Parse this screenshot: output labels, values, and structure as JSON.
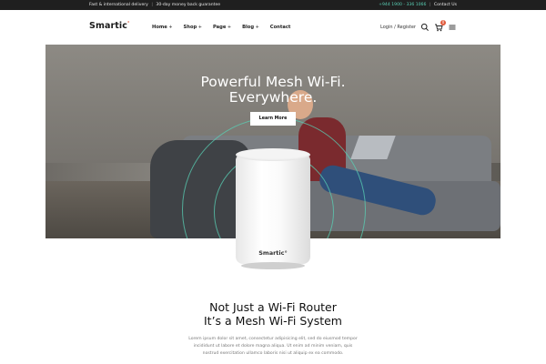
{
  "topbar": {
    "promo_left": "Fast & international delivery",
    "promo_right": "30-day money back guarantee",
    "phone": "+944 1900 - 336 1066",
    "contact": "Contact Us"
  },
  "header": {
    "logo": "Smartic",
    "logo_mark": "°",
    "nav": [
      {
        "label": "Home",
        "plus": "+"
      },
      {
        "label": "Shop",
        "plus": "+"
      },
      {
        "label": "Page",
        "plus": "+"
      },
      {
        "label": "Blog",
        "plus": "+"
      },
      {
        "label": "Contact",
        "plus": ""
      }
    ],
    "login": "Login / Register",
    "cart_count": "0",
    "icons": [
      "search-icon",
      "cart-icon",
      "menu-icon"
    ]
  },
  "hero": {
    "title_line1": "Powerful Mesh Wi-Fi.",
    "title_line2": "Everywhere.",
    "button": "Learn More"
  },
  "product": {
    "brand": "Smartic°"
  },
  "section": {
    "title_line1": "Not Just a Wi-Fi Router",
    "title_line2": "It’s a Mesh Wi-Fi System",
    "text_line1": "Lorem ipsum dolor sit amet, consectetur adipisicing elit, sed do eiusmod tempor",
    "text_line2": "incididunt ut labore et dolore magna aliqua. Ut enim ad minim veniam, quis",
    "text_line3": "nostrud exercitation ullamco laboris nisi ut aliquip ex ea commodo."
  },
  "colors": {
    "accent": "#5ad0b6",
    "badge": "#e05a3c",
    "topbar": "#1f1f1f"
  }
}
